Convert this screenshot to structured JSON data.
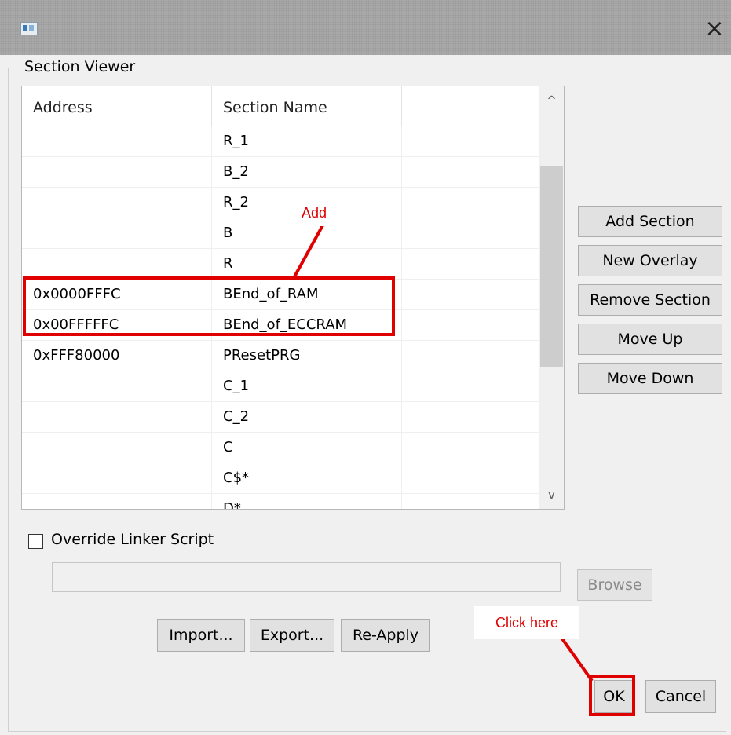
{
  "window": {
    "close_icon": "×",
    "app_icon": "app-icon"
  },
  "group": {
    "title": "Section Viewer"
  },
  "table": {
    "columns": [
      "Address",
      "Section Name",
      ""
    ],
    "rows": [
      {
        "address": "",
        "section": "R_1"
      },
      {
        "address": "",
        "section": "B_2"
      },
      {
        "address": "",
        "section": "R_2"
      },
      {
        "address": "",
        "section": "B"
      },
      {
        "address": "",
        "section": "R"
      },
      {
        "address": "0x0000FFFC",
        "section": "BEnd_of_RAM"
      },
      {
        "address": "0x00FFFFFC",
        "section": "BEnd_of_ECCRAM"
      },
      {
        "address": "0xFFF80000",
        "section": "PResetPRG"
      },
      {
        "address": "",
        "section": "C_1"
      },
      {
        "address": "",
        "section": "C_2"
      },
      {
        "address": "",
        "section": "C"
      },
      {
        "address": "",
        "section": "C$*"
      },
      {
        "address": "",
        "section": "D*"
      }
    ],
    "scroll_up_icon": "^",
    "scroll_down_icon": "v"
  },
  "side_buttons": {
    "add_section": "Add Section",
    "new_overlay": "New Overlay",
    "remove_section": "Remove Section",
    "move_up": "Move Up",
    "move_down": "Move Down"
  },
  "override": {
    "label": "Override Linker Script",
    "checked": false,
    "path_value": ""
  },
  "browse_button": "Browse",
  "bottom_buttons": {
    "import": "Import...",
    "export": "Export...",
    "reapply": "Re-Apply"
  },
  "dialog_buttons": {
    "ok": "OK",
    "cancel": "Cancel"
  },
  "annotations": {
    "add_label": "Add",
    "click_label": "Click here",
    "color": "#e00000"
  }
}
